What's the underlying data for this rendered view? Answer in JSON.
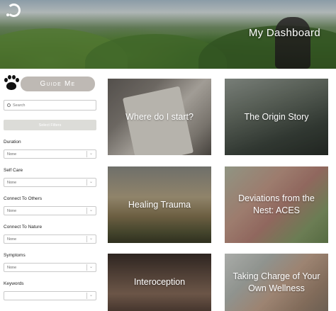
{
  "header": {
    "title": "My Dashboard",
    "logo_icon": "circle-logo-icon"
  },
  "sidebar": {
    "guide_button": "Guide Me",
    "guide_icon": "paw-icon",
    "search_placeholder": "Search",
    "select_filters_label": "Select Filters",
    "filters": [
      {
        "label": "Duration",
        "value": "None"
      },
      {
        "label": "Self Care",
        "value": "None"
      },
      {
        "label": "Connect To Others",
        "value": "None"
      },
      {
        "label": "Connect To Nature",
        "value": "None"
      },
      {
        "label": "Symptoms",
        "value": "None"
      },
      {
        "label": "Keywords",
        "value": ""
      }
    ]
  },
  "cards": [
    {
      "title": "Where do I start?"
    },
    {
      "title": "The Origin Story"
    },
    {
      "title": "Healing Trauma"
    },
    {
      "title": "Deviations from the Nest: ACES"
    },
    {
      "title": "Interoception"
    },
    {
      "title": "Taking Charge of Your Own Wellness"
    }
  ]
}
